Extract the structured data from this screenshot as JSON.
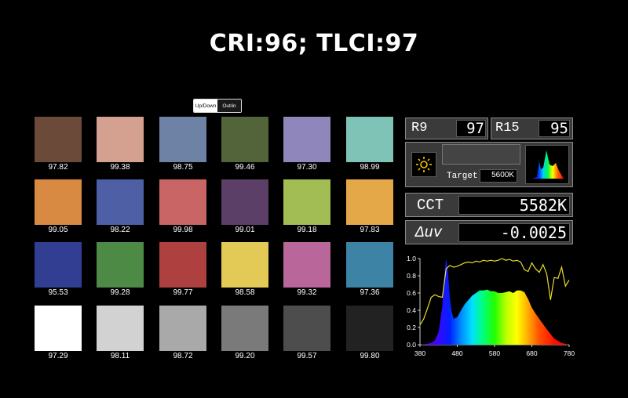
{
  "title": "CRI:96; TLCI:97",
  "toggle": {
    "left": "Up/Down",
    "right": "Out/in"
  },
  "swatches": [
    {
      "color": "#6b4a3a",
      "value": "97.82"
    },
    {
      "color": "#d4a190",
      "value": "99.38"
    },
    {
      "color": "#6d82a4",
      "value": "98.75"
    },
    {
      "color": "#53633a",
      "value": "99.46"
    },
    {
      "color": "#8f86bb",
      "value": "97.30"
    },
    {
      "color": "#7fc2b6",
      "value": "98.99"
    },
    {
      "color": "#d98a42",
      "value": "99.05"
    },
    {
      "color": "#4e5fa5",
      "value": "98.22"
    },
    {
      "color": "#c96565",
      "value": "99.98"
    },
    {
      "color": "#5b3f66",
      "value": "99.01"
    },
    {
      "color": "#a3bd55",
      "value": "99.18"
    },
    {
      "color": "#e5a848",
      "value": "97.83"
    },
    {
      "color": "#323e92",
      "value": "95.53"
    },
    {
      "color": "#4d8a46",
      "value": "99.28"
    },
    {
      "color": "#ae4040",
      "value": "99.77"
    },
    {
      "color": "#e3c955",
      "value": "98.58"
    },
    {
      "color": "#b9679a",
      "value": "99.32"
    },
    {
      "color": "#3d83a5",
      "value": "97.36"
    },
    {
      "color": "#ffffff",
      "value": "97.29"
    },
    {
      "color": "#d2d2d2",
      "value": "98.11"
    },
    {
      "color": "#a9a9a9",
      "value": "98.72"
    },
    {
      "color": "#7a7a7a",
      "value": "99.20"
    },
    {
      "color": "#4d4d4d",
      "value": "99.57"
    },
    {
      "color": "#222222",
      "value": "99.80"
    }
  ],
  "meter": {
    "r9_label": "R9",
    "r9_value": "97",
    "r15_label": "R15",
    "r15_value": "95",
    "target_label": "Target",
    "target_value": "5600K",
    "cct_label": "CCT",
    "cct_value": "5582K",
    "duv_label": "Δuv",
    "duv_value": "-0.0025",
    "sun_icon": "sun-icon",
    "thumb_icon": "spectrum-thumbnail-icon"
  },
  "chart_data": {
    "type": "area",
    "x_ticks": [
      "380",
      "480",
      "580",
      "680",
      "780"
    ],
    "y_ticks": [
      "0.0",
      "0.2",
      "0.4",
      "0.6",
      "0.8",
      "1.0"
    ],
    "xlim": [
      380,
      780
    ],
    "ylim": [
      0,
      1.0
    ],
    "series": [
      {
        "values_x": [
          380,
          400,
          410,
          420,
          430,
          440,
          445,
          450,
          455,
          460,
          465,
          470,
          480,
          490,
          500,
          510,
          520,
          530,
          540,
          550,
          560,
          570,
          580,
          590,
          600,
          610,
          620,
          630,
          640,
          650,
          660,
          670,
          680,
          690,
          700,
          720,
          740,
          760,
          780
        ],
        "values_y": [
          0,
          0.01,
          0.02,
          0.05,
          0.15,
          0.45,
          0.8,
          1.0,
          0.85,
          0.55,
          0.38,
          0.3,
          0.32,
          0.4,
          0.47,
          0.52,
          0.57,
          0.6,
          0.63,
          0.63,
          0.64,
          0.62,
          0.62,
          0.6,
          0.6,
          0.61,
          0.62,
          0.6,
          0.63,
          0.63,
          0.61,
          0.53,
          0.43,
          0.36,
          0.3,
          0.18,
          0.07,
          0.02,
          0.0
        ]
      },
      {
        "values_x": [
          380,
          390,
          400,
          410,
          420,
          430,
          440,
          450,
          460,
          470,
          480,
          490,
          500,
          510,
          520,
          530,
          540,
          550,
          560,
          570,
          580,
          590,
          600,
          610,
          620,
          630,
          640,
          650,
          660,
          670,
          680,
          690,
          700,
          710,
          720,
          730,
          740,
          750,
          760,
          770,
          780
        ],
        "values_y": [
          0.23,
          0.3,
          0.42,
          0.55,
          0.58,
          0.56,
          0.55,
          0.88,
          0.92,
          0.9,
          0.91,
          0.93,
          0.95,
          0.96,
          0.95,
          0.97,
          0.96,
          0.98,
          0.97,
          0.98,
          0.97,
          0.98,
          1.0,
          0.98,
          0.99,
          0.97,
          0.98,
          0.96,
          0.87,
          0.85,
          0.95,
          0.88,
          0.84,
          0.93,
          0.82,
          0.52,
          0.78,
          0.77,
          0.9,
          0.68,
          0.75
        ]
      }
    ],
    "grid": false
  }
}
